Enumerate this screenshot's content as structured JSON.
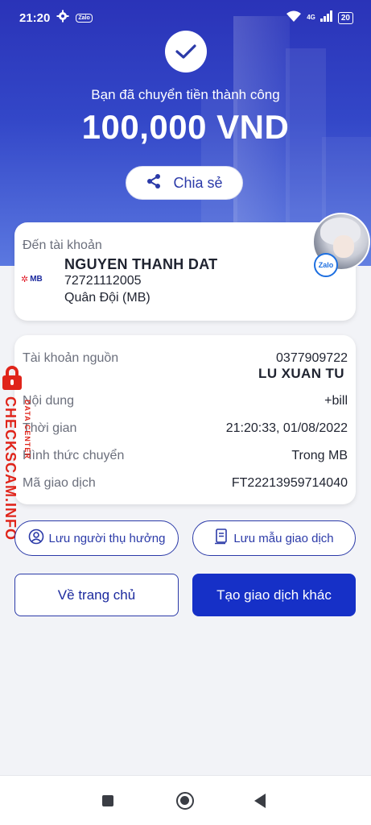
{
  "status_bar": {
    "time": "21:20",
    "zalo_label": "Zalo",
    "network": "4G",
    "battery": "20"
  },
  "hero": {
    "subtitle": "Bạn đã chuyển tiền thành công",
    "amount": "100,000 VND",
    "share_label": "Chia sẻ"
  },
  "recipient": {
    "label": "Đến tài khoản",
    "name": "NGUYEN THANH DAT",
    "account_number": "72721112005",
    "bank": "Quân Đội (MB)",
    "bank_logo": "MB",
    "badge": "Zalo"
  },
  "details": {
    "rows": [
      {
        "label": "Tài khoản nguồn",
        "value": "0377909722"
      },
      {
        "label": "Nội dung",
        "value": "+bill"
      },
      {
        "label": "Thời gian",
        "value": "21:20:33, 01/08/2022"
      },
      {
        "label": "Hình thức chuyển",
        "value": "Trong MB"
      },
      {
        "label": "Mã giao dịch",
        "value": "FT22213959714040"
      }
    ],
    "source_name": "LU XUAN TU"
  },
  "watermark": {
    "main": "CHECKSCAM.INFO",
    "sub": "DATA CENTER"
  },
  "actions": {
    "save_beneficiary": "Lưu người thụ hưởng",
    "save_template": "Lưu mẫu giao dịch",
    "home": "Về trang chủ",
    "new_transaction": "Tạo giao dịch khác"
  },
  "colors": {
    "primary": "#1630c7",
    "hero_top": "#2a33b8",
    "watermark": "#e0241a"
  }
}
